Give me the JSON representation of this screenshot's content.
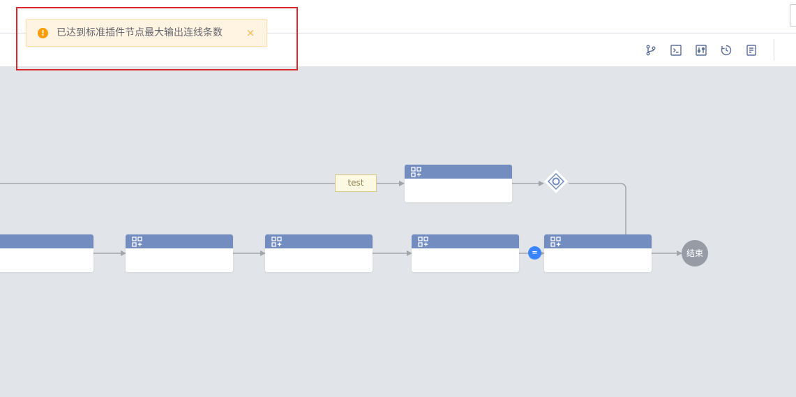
{
  "notification": {
    "icon": "warning-icon",
    "icon_glyph": "!",
    "message": "已达到标准插件节点最大输出连线条数",
    "close_glyph": "×"
  },
  "toolbar": {
    "buttons": [
      {
        "icon": "branch-icon"
      },
      {
        "icon": "terminal-icon"
      },
      {
        "icon": "variable-settings-icon"
      },
      {
        "icon": "history-icon"
      },
      {
        "icon": "document-icon"
      }
    ]
  },
  "canvas": {
    "branch_label": "test",
    "end_node_label": "结束",
    "link_marker": "="
  },
  "colors": {
    "node_header": "#738dc0",
    "canvas_bg": "#e1e4e8",
    "edge": "#a3a5ab",
    "toast_bg": "#fff4e2",
    "toast_icon": "#ff9c01",
    "highlight": "#d9282d",
    "end_node": "#979ba5",
    "link_marker": "#3a84ff"
  }
}
